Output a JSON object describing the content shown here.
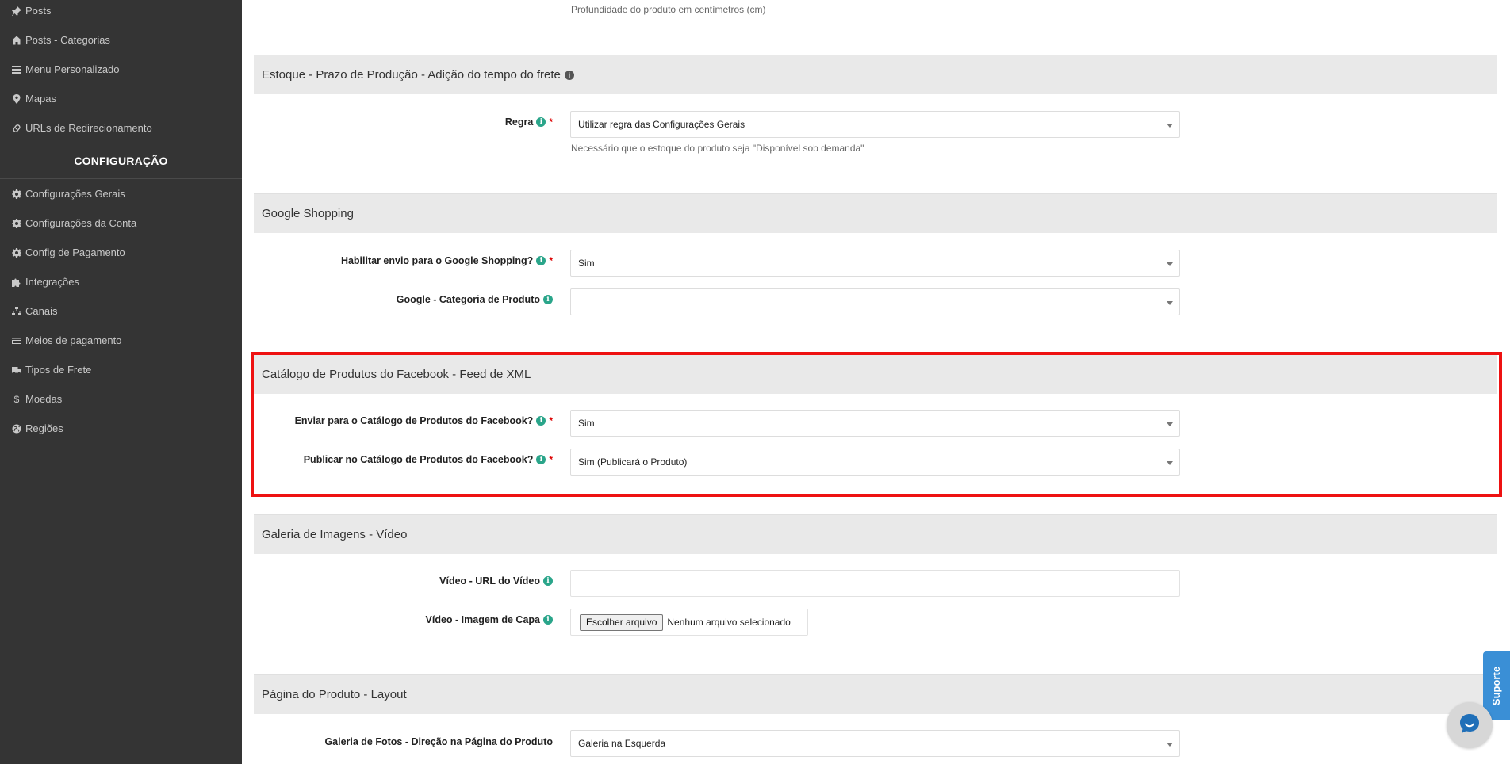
{
  "sidebar": {
    "items_top": [
      {
        "label": "Posts",
        "icon": "pin-icon"
      },
      {
        "label": "Posts - Categorias",
        "icon": "home-icon"
      },
      {
        "label": "Menu Personalizado",
        "icon": "list-icon"
      },
      {
        "label": "Mapas",
        "icon": "map-marker-icon"
      },
      {
        "label": "URLs de Redirecionamento",
        "icon": "link-icon"
      }
    ],
    "heading": "CONFIGURAÇÃO",
    "items_config": [
      {
        "label": "Configurações Gerais",
        "icon": "gear-icon"
      },
      {
        "label": "Configurações da Conta",
        "icon": "gear-icon"
      },
      {
        "label": "Config de Pagamento",
        "icon": "gear-icon"
      },
      {
        "label": "Integrações",
        "icon": "puzzle-icon"
      },
      {
        "label": "Canais",
        "icon": "sitemap-icon"
      },
      {
        "label": "Meios de pagamento",
        "icon": "credit-card-icon"
      },
      {
        "label": "Tipos de Frete",
        "icon": "truck-icon"
      },
      {
        "label": "Moedas",
        "icon": "dollar-icon"
      },
      {
        "label": "Regiões",
        "icon": "globe-icon"
      }
    ]
  },
  "main": {
    "depth_help": "Profundidade do produto em centímetros (cm)",
    "estoque": {
      "title": "Estoque - Prazo de Produção - Adição do tempo do frete",
      "rule_label": "Regra",
      "rule_value": "Utilizar regra das Configurações Gerais",
      "rule_help": "Necessário que o estoque do produto seja \"Disponível sob demanda\""
    },
    "google": {
      "title": "Google Shopping",
      "enable_label": "Habilitar envio para o Google Shopping?",
      "enable_value": "Sim",
      "category_label": "Google - Categoria de Produto",
      "category_value": ""
    },
    "facebook": {
      "title": "Catálogo de Produtos do Facebook - Feed de XML",
      "send_label": "Enviar para o Catálogo de Produtos do Facebook?",
      "send_value": "Sim",
      "publish_label": "Publicar no Catálogo de Produtos do Facebook?",
      "publish_value": "Sim (Publicará o Produto)"
    },
    "galeria": {
      "title": "Galeria de Imagens - Vídeo",
      "url_label": "Vídeo - URL do Vídeo",
      "cover_label": "Vídeo - Imagem de Capa",
      "file_button": "Escolher arquivo",
      "file_status": "Nenhum arquivo selecionado"
    },
    "layout": {
      "title": "Página do Produto - Layout",
      "gallery_label": "Galeria de Fotos - Direção na Página do Produto",
      "gallery_value": "Galeria na Esquerda"
    }
  },
  "widgets": {
    "support_label": "Suporte"
  },
  "colors": {
    "sidebar_bg": "#343434",
    "info_green": "#2aa58a",
    "highlight_red": "#ee1111",
    "support_blue": "#3a8fd6"
  }
}
